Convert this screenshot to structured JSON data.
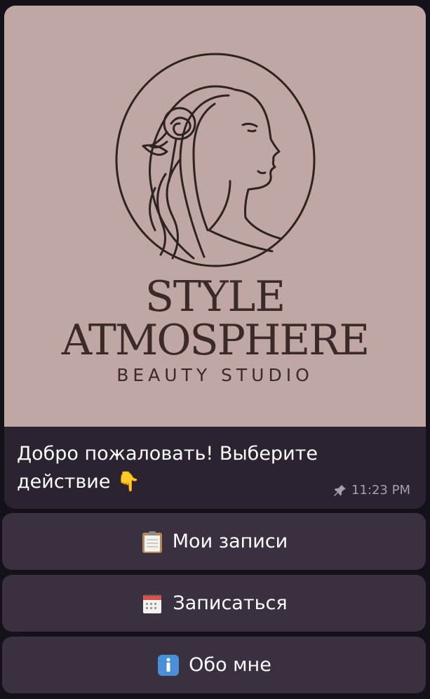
{
  "logo": {
    "line1": "STYLE",
    "line2": "ATMOSPHERE",
    "subtitle": "BEAUTY STUDIO"
  },
  "message": {
    "text": "Добро пожаловать! Выберите действие 👇",
    "time": "11:23 PM"
  },
  "keyboard": {
    "buttons": [
      {
        "icon": "clipboard-icon",
        "label": "Мои записи"
      },
      {
        "icon": "calendar-icon",
        "label": "Записаться"
      },
      {
        "icon": "info-icon",
        "label": "Обо мне"
      }
    ]
  },
  "colors": {
    "poster_bg": "#c1a7a3",
    "ink": "#3a2a2a",
    "bubble": "#2c2331",
    "button_bg": "#3a3040",
    "meta_text": "#a99cae"
  }
}
